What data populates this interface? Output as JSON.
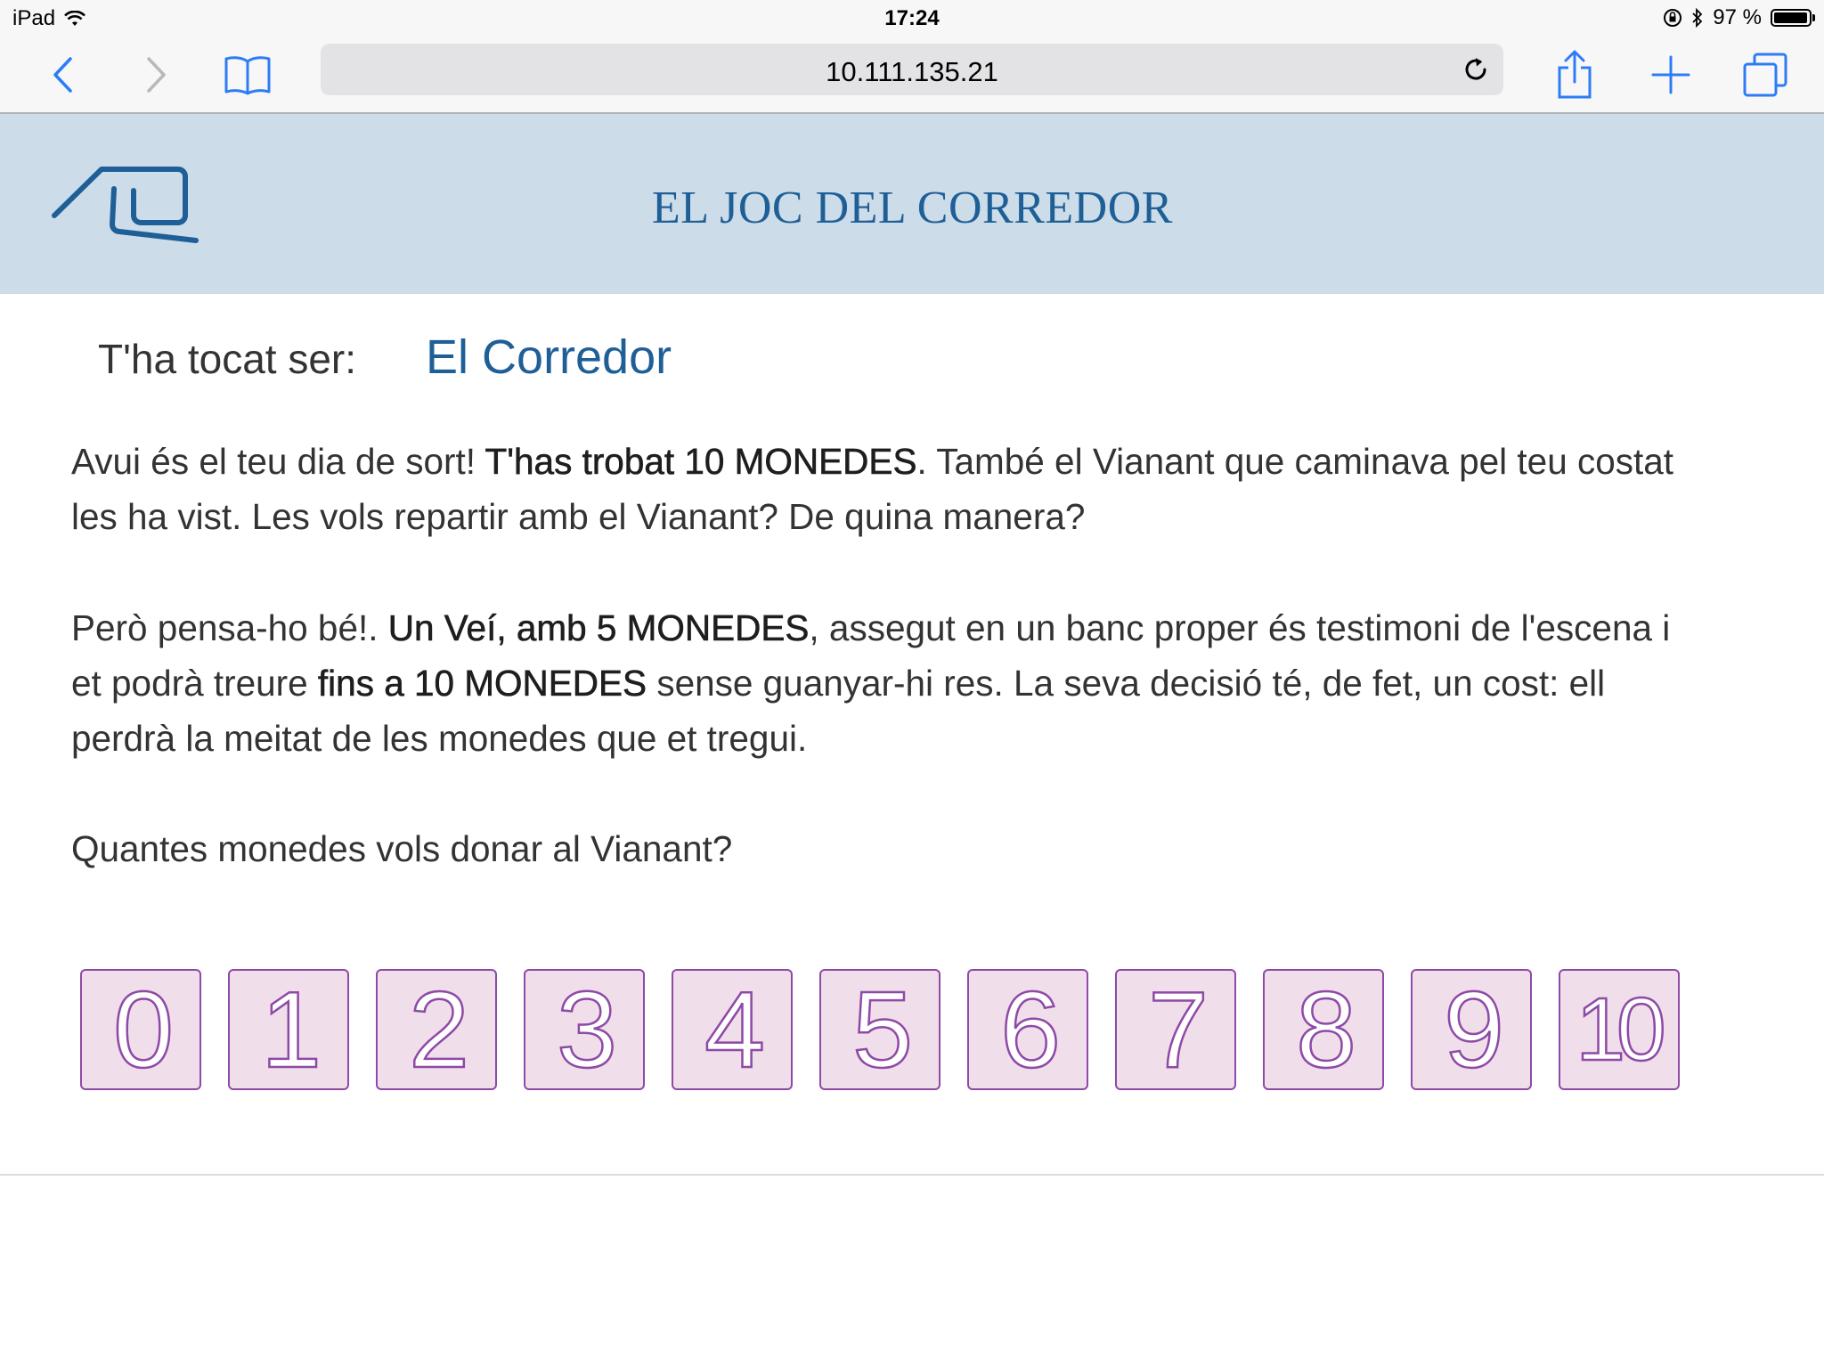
{
  "status_bar": {
    "device": "iPad",
    "time": "17:24",
    "battery": "97 %",
    "battery_level": 0.97
  },
  "browser": {
    "url": "10.111.135.21"
  },
  "header": {
    "title": "EL JOC DEL CORREDOR"
  },
  "role": {
    "label": "T'ha tocat ser:",
    "value": "El Corredor"
  },
  "paragraph1": {
    "t1": "Avui és el teu dia de sort! ",
    "b1": "T'has trobat 10 MONEDES",
    "t2": ". També el Vianant que caminava pel teu costat les ha vist. Les vols repartir amb el Vianant? De quina manera?"
  },
  "paragraph2": {
    "t1": "Però pensa-ho bé!. ",
    "b1": "Un Veí, amb 5 MONEDES",
    "t2": ", assegut en un banc proper és testimoni de l'escena i et podrà treure ",
    "b2": "fins a 10 MONEDES",
    "t3": " sense guanyar-hi res. La seva decisió té, de fet, un cost: ell perdrà la meitat de les monedes que et tregui."
  },
  "question": "Quantes monedes vols donar al Vianant?",
  "choices": [
    "0",
    "1",
    "2",
    "3",
    "4",
    "5",
    "6",
    "7",
    "8",
    "9",
    "10"
  ],
  "colors": {
    "header_bg": "#ccdce8",
    "accent_blue": "#1f5f97",
    "choice_bg": "#f0dfea",
    "choice_border": "#8e4aa6"
  }
}
